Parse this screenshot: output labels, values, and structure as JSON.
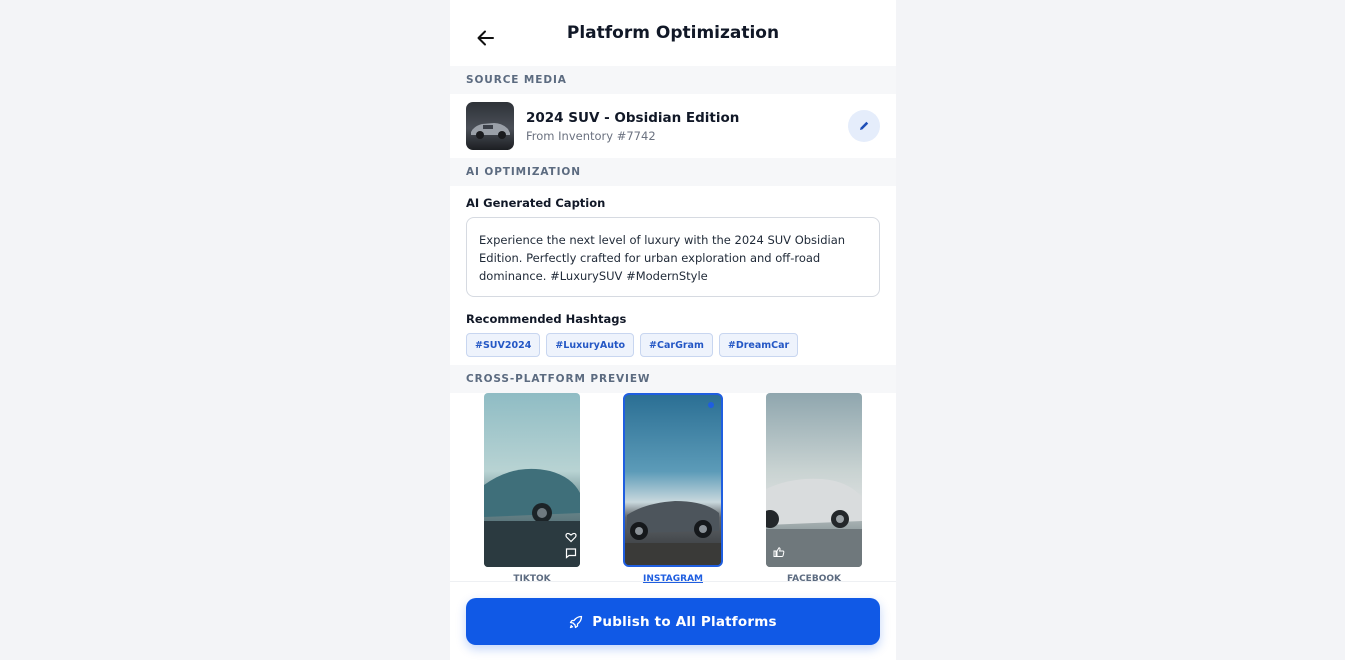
{
  "header": {
    "title": "Platform Optimization",
    "back_icon": "arrow-left-icon"
  },
  "source_media": {
    "section_label": "SOURCE MEDIA",
    "title": "2024 SUV - Obsidian Edition",
    "subtitle": "From Inventory #7742",
    "edit_icon": "pencil-icon"
  },
  "ai_optimization": {
    "section_label": "AI OPTIMIZATION",
    "caption_label": "AI Generated Caption",
    "caption": "Experience the next level of luxury with the 2024 SUV Obsidian Edition. Perfectly crafted for urban exploration and off-road dominance. #LuxurySUV #ModernStyle",
    "hashtags_label": "Recommended Hashtags",
    "hashtags": [
      "#SUV2024",
      "#LuxuryAuto",
      "#CarGram",
      "#DreamCar"
    ]
  },
  "preview": {
    "section_label": "CROSS-PLATFORM PREVIEW",
    "platforms": [
      {
        "label": "TIKTOK",
        "selected": false
      },
      {
        "label": "INSTAGRAM",
        "selected": true
      },
      {
        "label": "FACEBOOK",
        "selected": false
      }
    ]
  },
  "publish": {
    "label": "Publish to All Platforms",
    "icon": "rocket-icon"
  },
  "colors": {
    "accent": "#1059e6",
    "tag_text": "#2457c5",
    "section_text": "#5c6b80"
  }
}
